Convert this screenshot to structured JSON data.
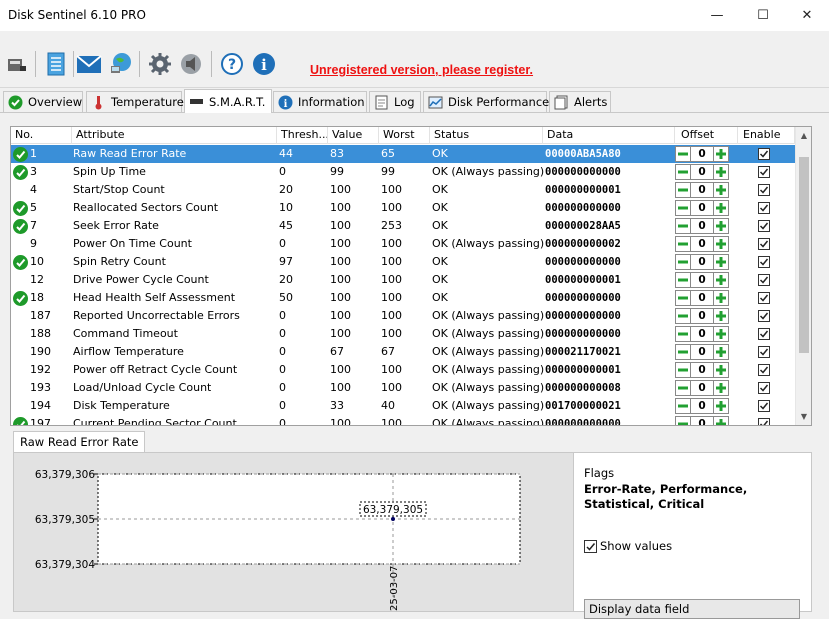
{
  "window": {
    "title": "Disk Sentinel 6.10 PRO",
    "minimize": "—",
    "maximize": "☐",
    "close": "✕"
  },
  "toolbar": {
    "register_link": "Unregistered version, please register.",
    "icons": [
      "drive-icon",
      "report-icon",
      "email-icon",
      "network-icon",
      "settings-icon",
      "sound-icon",
      "help-icon",
      "info-icon"
    ]
  },
  "tabs": [
    {
      "label": "Overview",
      "icon": "check-icon"
    },
    {
      "label": "Temperature",
      "icon": "thermometer-icon"
    },
    {
      "label": "S.M.A.R.T.",
      "icon": "drive-icon",
      "active": true
    },
    {
      "label": "Information",
      "icon": "info-icon"
    },
    {
      "label": "Log",
      "icon": "log-icon"
    },
    {
      "label": "Disk Performance",
      "icon": "chart-icon"
    },
    {
      "label": "Alerts",
      "icon": "alerts-icon"
    }
  ],
  "grid": {
    "columns": [
      "No.",
      "Attribute",
      "Thresh...",
      "Value",
      "Worst",
      "Status",
      "Data",
      "Offset",
      "Enable"
    ],
    "rows": [
      {
        "no": "1",
        "attr": "Raw Read Error Rate",
        "thresh": "44",
        "value": "83",
        "worst": "65",
        "status": "OK",
        "data": "00000ABA5A80",
        "offset": "0",
        "ok": true,
        "selected": true
      },
      {
        "no": "3",
        "attr": "Spin Up Time",
        "thresh": "0",
        "value": "99",
        "worst": "99",
        "status": "OK (Always passing)",
        "data": "000000000000",
        "offset": "0",
        "ok": true
      },
      {
        "no": "4",
        "attr": "Start/Stop Count",
        "thresh": "20",
        "value": "100",
        "worst": "100",
        "status": "OK",
        "data": "000000000001",
        "offset": "0",
        "ok": false
      },
      {
        "no": "5",
        "attr": "Reallocated Sectors Count",
        "thresh": "10",
        "value": "100",
        "worst": "100",
        "status": "OK",
        "data": "000000000000",
        "offset": "0",
        "ok": true
      },
      {
        "no": "7",
        "attr": "Seek Error Rate",
        "thresh": "45",
        "value": "100",
        "worst": "253",
        "status": "OK",
        "data": "000000028AA5",
        "offset": "0",
        "ok": true
      },
      {
        "no": "9",
        "attr": "Power On Time Count",
        "thresh": "0",
        "value": "100",
        "worst": "100",
        "status": "OK (Always passing)",
        "data": "000000000002",
        "offset": "0",
        "ok": false
      },
      {
        "no": "10",
        "attr": "Spin Retry Count",
        "thresh": "97",
        "value": "100",
        "worst": "100",
        "status": "OK",
        "data": "000000000000",
        "offset": "0",
        "ok": true
      },
      {
        "no": "12",
        "attr": "Drive Power Cycle Count",
        "thresh": "20",
        "value": "100",
        "worst": "100",
        "status": "OK",
        "data": "000000000001",
        "offset": "0",
        "ok": false
      },
      {
        "no": "18",
        "attr": "Head Health Self Assessment",
        "thresh": "50",
        "value": "100",
        "worst": "100",
        "status": "OK",
        "data": "000000000000",
        "offset": "0",
        "ok": true
      },
      {
        "no": "187",
        "attr": "Reported Uncorrectable Errors",
        "thresh": "0",
        "value": "100",
        "worst": "100",
        "status": "OK (Always passing)",
        "data": "000000000000",
        "offset": "0",
        "ok": false
      },
      {
        "no": "188",
        "attr": "Command Timeout",
        "thresh": "0",
        "value": "100",
        "worst": "100",
        "status": "OK (Always passing)",
        "data": "000000000000",
        "offset": "0",
        "ok": false
      },
      {
        "no": "190",
        "attr": "Airflow Temperature",
        "thresh": "0",
        "value": "67",
        "worst": "67",
        "status": "OK (Always passing)",
        "data": "000021170021",
        "offset": "0",
        "ok": false
      },
      {
        "no": "192",
        "attr": "Power off Retract Cycle Count",
        "thresh": "0",
        "value": "100",
        "worst": "100",
        "status": "OK (Always passing)",
        "data": "000000000001",
        "offset": "0",
        "ok": false
      },
      {
        "no": "193",
        "attr": "Load/Unload Cycle Count",
        "thresh": "0",
        "value": "100",
        "worst": "100",
        "status": "OK (Always passing)",
        "data": "000000000008",
        "offset": "0",
        "ok": false
      },
      {
        "no": "194",
        "attr": "Disk Temperature",
        "thresh": "0",
        "value": "33",
        "worst": "40",
        "status": "OK (Always passing)",
        "data": "001700000021",
        "offset": "0",
        "ok": false
      },
      {
        "no": "197",
        "attr": "Current Pending Sector Count",
        "thresh": "0",
        "value": "100",
        "worst": "100",
        "status": "OK (Always passing)",
        "data": "000000000000",
        "offset": "0",
        "ok": true
      }
    ]
  },
  "detail": {
    "tab_label": "Raw Read Error Rate",
    "flags_title": "Flags",
    "flags_value": "Error-Rate, Performance, Statistical, Critical",
    "show_values_label": "Show values",
    "display_dropdown": "Display data field"
  },
  "chart_data": {
    "type": "line",
    "title": "",
    "xlabel": "",
    "ylabel": "",
    "y_ticks": [
      "63,379,306",
      "63,379,305",
      "63,379,304"
    ],
    "ylim": [
      63379304,
      63379306
    ],
    "x": [
      "25-03-07"
    ],
    "series": [
      {
        "values": [
          63379305
        ]
      }
    ],
    "data_labels": [
      "63,379,305"
    ]
  }
}
